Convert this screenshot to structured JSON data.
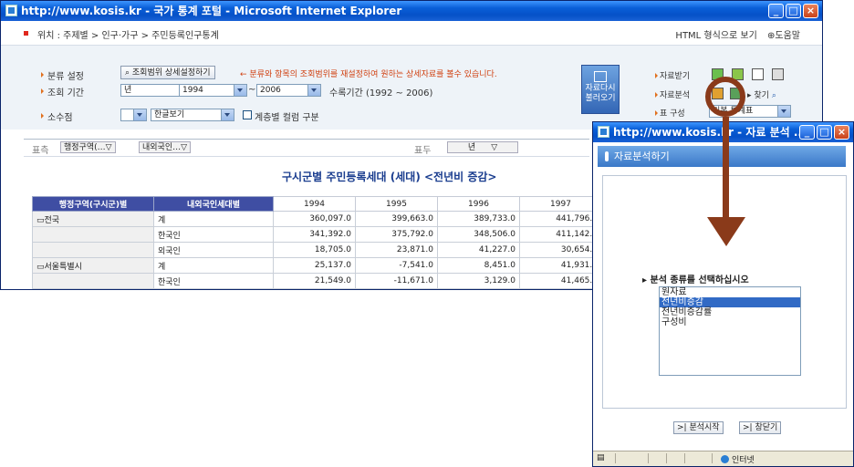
{
  "main_window": {
    "title": "http://www.kosis.kr - 국가 통계 포털 - Microsoft Internet Explorer",
    "breadcrumb": "위치 : 주제별 > 인구·가구 > 주민등록인구통계",
    "html_view": "HTML 형식으로 보기",
    "help": "도움말",
    "labels": {
      "classification": "분류 설정",
      "period": "조회 기간",
      "decimal": "소수점"
    },
    "detail_button": "조회범위 상세설정하기",
    "detail_note": "← 분류와 항목의 조회범위를 재설정하여 원하는 상세자료를 볼수 있습니다.",
    "period_unit": "년",
    "period_from": "1994",
    "period_to": "2006",
    "period_tilde": "~",
    "period_info": "수록기간 (1992 ~ 2006)",
    "decimal_value": "",
    "view_mode": "한글보기",
    "hier_checkbox": "계층별 컬럼 구분",
    "reload_button": [
      "자료다시",
      "불러오기"
    ],
    "right_menu": {
      "download": "자료받기",
      "analysis": "자료분석",
      "find": "찾기",
      "layout_label": "표 구성",
      "layout_value": "기본 통계표"
    },
    "pivot": {
      "row_label": "표측",
      "row_chips": [
        "행정구역(…▽",
        "내외국인…▽"
      ],
      "col_label": "표두",
      "col_chip": "년",
      "col_chip_arrow": "▽"
    },
    "table": {
      "title": "구시군별 주민등록세대 (세대) <전년비 증감>",
      "head_region": "행정구역(구시군)별",
      "head_nat": "내외국인세대별",
      "years": [
        "1994",
        "1995",
        "1996",
        "1997"
      ],
      "rows": [
        {
          "region": "▭전국",
          "nat": "계",
          "vals": [
            "360,097.0",
            "399,663.0",
            "389,733.0",
            "441,796.0"
          ]
        },
        {
          "region": "",
          "nat": "한국인",
          "vals": [
            "341,392.0",
            "375,792.0",
            "348,506.0",
            "411,142.0"
          ]
        },
        {
          "region": "",
          "nat": "외국인",
          "vals": [
            "18,705.0",
            "23,871.0",
            "41,227.0",
            "30,654.0"
          ]
        },
        {
          "region": "▭서울특별시",
          "nat": "계",
          "vals": [
            "25,137.0",
            "-7,541.0",
            "8,451.0",
            "41,931.0"
          ]
        },
        {
          "region": "",
          "nat": "한국인",
          "vals": [
            "21,549.0",
            "-11,671.0",
            "3,129.0",
            "41,465.0"
          ]
        }
      ]
    }
  },
  "popup": {
    "title": "http://www.kosis.kr - 자료 분석 ...",
    "header": "자료분석하기",
    "prompt": "분석 종류를 선택하십시오",
    "options": [
      "원자료",
      "전년비증감",
      "전년비증감률",
      "구성비"
    ],
    "selected_index": 1,
    "start_button": "분석시작",
    "close_button": "창닫기",
    "status_zone": "인터넷"
  },
  "colors": {
    "titlebar": "#0551c8",
    "table_header": "#3f4ea3",
    "table_title": "#1a3d8f",
    "highlight_arrow": "#8a3a1a",
    "note_text": "#d04010"
  }
}
